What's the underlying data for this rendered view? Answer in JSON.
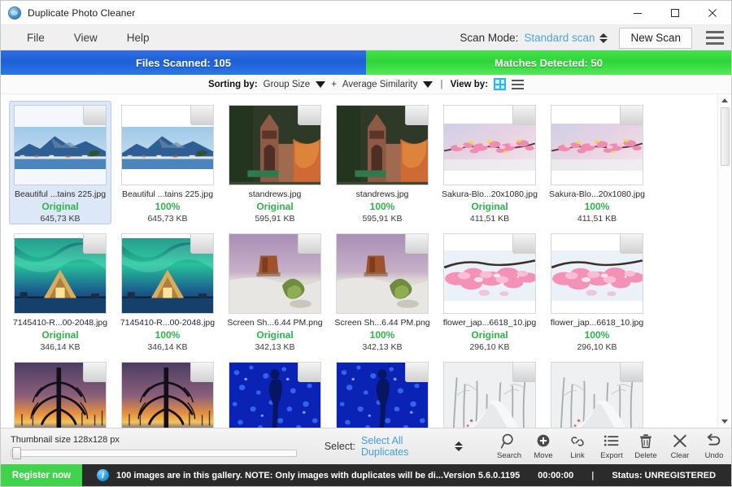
{
  "window": {
    "title": "Duplicate Photo Cleaner",
    "app_icon": "app-globe-icon",
    "minimize": "─",
    "maximize": "☐",
    "close": "✕"
  },
  "menubar": {
    "items": [
      {
        "label": "File"
      },
      {
        "label": "View"
      },
      {
        "label": "Help"
      }
    ],
    "scan_mode_label": "Scan Mode:",
    "scan_mode_value": "Standard scan",
    "new_scan_label": "New Scan",
    "hamburger": "menu-icon"
  },
  "counters": {
    "files_scanned": "Files Scanned: 105",
    "matches_detected": "Matches Detected: 50",
    "files_color": "#2466dd",
    "matches_color": "#35d93d"
  },
  "sortbar": {
    "sorting_label": "Sorting by:",
    "primary_sort": "Group Size",
    "plus": "+",
    "secondary_sort": "Average Similarity",
    "separator": "|",
    "view_label": "View by:",
    "view_grid_icon": "grid-view-icon",
    "view_list_icon": "list-view-icon"
  },
  "gallery": {
    "cards": [
      {
        "filename": "Beautiful ...tains 225.jpg",
        "status": "Original",
        "size": "645,73 KB",
        "selected": true,
        "image": "mountain-lake"
      },
      {
        "filename": "Beautiful ...tains 225.jpg",
        "status": "100%",
        "size": "645,73 KB",
        "selected": false,
        "image": "mountain-lake"
      },
      {
        "filename": "standrews.jpg",
        "status": "Original",
        "size": "595,91 KB",
        "selected": false,
        "image": "church-autumn"
      },
      {
        "filename": "standrews.jpg",
        "status": "100%",
        "size": "595,91 KB",
        "selected": false,
        "image": "church-autumn"
      },
      {
        "filename": "Sakura-Blo...20x1080.jpg",
        "status": "Original",
        "size": "411,51 KB",
        "selected": false,
        "image": "sakura-branch"
      },
      {
        "filename": "Sakura-Blo...20x1080.jpg",
        "status": "100%",
        "size": "411,51 KB",
        "selected": false,
        "image": "sakura-branch"
      },
      {
        "filename": "7145410-R...00-2048.jpg",
        "status": "Original",
        "size": "346,14 KB",
        "selected": false,
        "image": "aurora-cabin"
      },
      {
        "filename": "7145410-R...00-2048.jpg",
        "status": "100%",
        "size": "346,14 KB",
        "selected": false,
        "image": "aurora-cabin"
      },
      {
        "filename": "Screen Sh...6.44 PM.png",
        "status": "Original",
        "size": "342,13 KB",
        "selected": false,
        "image": "desert-rock"
      },
      {
        "filename": "Screen Sh...6.44 PM.png",
        "status": "100%",
        "size": "342,13 KB",
        "selected": false,
        "image": "desert-rock"
      },
      {
        "filename": "flower_jap...6618_10.jpg",
        "status": "Original",
        "size": "296,10 KB",
        "selected": false,
        "image": "pink-blossom"
      },
      {
        "filename": "flower_jap...6618_10.jpg",
        "status": "100%",
        "size": "296,10 KB",
        "selected": false,
        "image": "pink-blossom"
      },
      {
        "filename": "",
        "status": "",
        "size": "",
        "selected": false,
        "image": "sunset-tree"
      },
      {
        "filename": "",
        "status": "",
        "size": "",
        "selected": false,
        "image": "sunset-tree"
      },
      {
        "filename": "",
        "status": "",
        "size": "",
        "selected": false,
        "image": "blue-lights"
      },
      {
        "filename": "",
        "status": "",
        "size": "",
        "selected": false,
        "image": "blue-lights"
      },
      {
        "filename": "",
        "status": "",
        "size": "",
        "selected": false,
        "image": "snow-path"
      },
      {
        "filename": "",
        "status": "",
        "size": "",
        "selected": false,
        "image": "snow-path"
      }
    ],
    "original_color": "#2fb34a"
  },
  "bottombar": {
    "thumbnail_size_label": "Thumbnail size 128x128 px",
    "select_label": "Select:",
    "select_value": "Select All Duplicates",
    "actions": [
      {
        "label": "Search",
        "icon": "search-icon"
      },
      {
        "label": "Move",
        "icon": "move-icon"
      },
      {
        "label": "Link",
        "icon": "link-icon"
      },
      {
        "label": "Export",
        "icon": "export-icon"
      },
      {
        "label": "Delete",
        "icon": "trash-icon"
      },
      {
        "label": "Clear",
        "icon": "close-icon"
      },
      {
        "label": "Undo",
        "icon": "undo-icon"
      }
    ]
  },
  "statusbar": {
    "register_label": "Register now",
    "info_icon": "info-icon",
    "note": "100 images are in this gallery. NOTE: Only images with duplicates will be di...",
    "version": "Version 5.6.0.1195",
    "timer": "00:00:00",
    "pipe": "|",
    "status": "Status: UNREGISTERED"
  }
}
